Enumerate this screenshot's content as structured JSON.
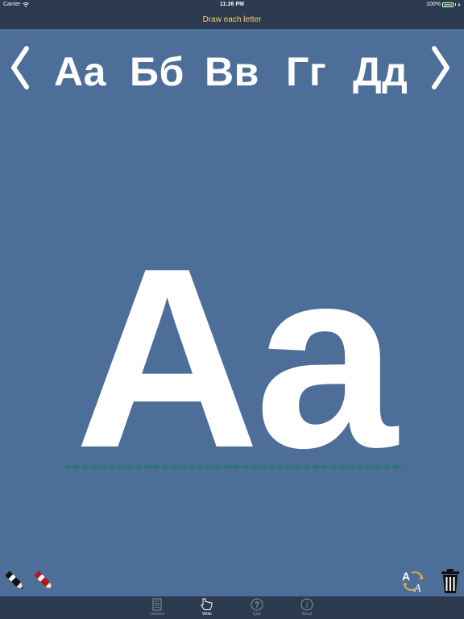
{
  "status_bar": {
    "carrier": "Carrier",
    "time": "11:26 PM",
    "battery": "100%"
  },
  "header": {
    "title": "Draw each letter"
  },
  "letter_nav": {
    "previous_icon": "chevron-left-icon",
    "next_icon": "chevron-right-icon",
    "letters": [
      "Aa",
      "Бб",
      "Вв",
      "Гг",
      "Дд"
    ]
  },
  "practice": {
    "current_letter": "Aa"
  },
  "tools": {
    "left": [
      "black-pen-icon",
      "red-pen-icon"
    ],
    "right": [
      "swap-letter-icon",
      "trash-icon"
    ]
  },
  "tab_bar": {
    "tabs": [
      {
        "label": "Lessons",
        "icon": "book-icon"
      },
      {
        "label": "Write",
        "icon": "hand-pointer-icon"
      },
      {
        "label": "Quiz",
        "icon": "question-icon"
      },
      {
        "label": "About",
        "icon": "info-icon"
      }
    ],
    "active": "Write"
  },
  "colors": {
    "background": "#4c6e99",
    "bar": "#2b3a4e",
    "header_text": "#f2d27a",
    "letters": "#ffffff",
    "baseline": "#2d7a74",
    "battery": "#4cd964"
  }
}
